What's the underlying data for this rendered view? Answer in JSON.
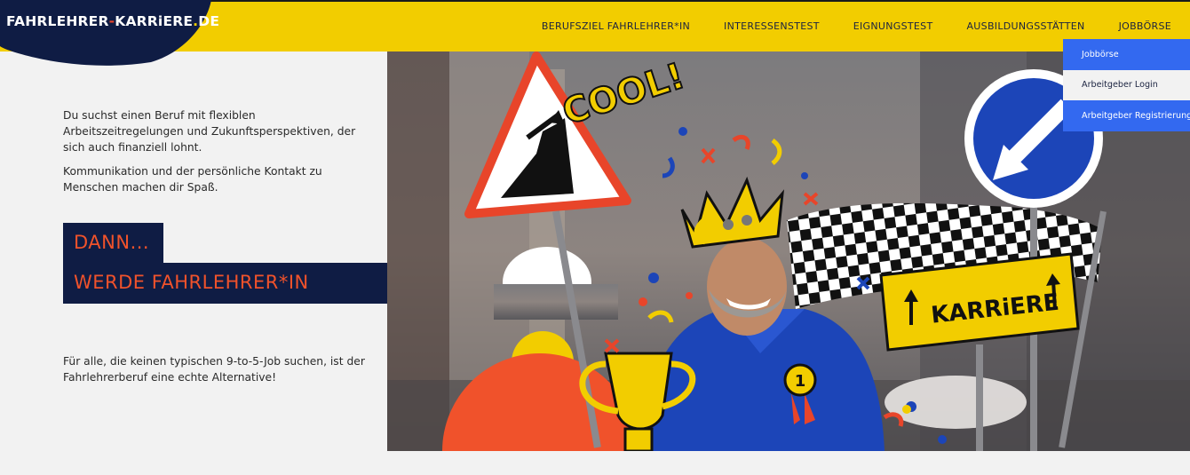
{
  "logo": {
    "part1": "FAHRLEHRER",
    "dash": "-",
    "part2": "KARRiERE",
    "dot": ".",
    "part3": "DE"
  },
  "nav": {
    "items": [
      {
        "label": "BERUFSZIEL FAHRLEHRER*IN"
      },
      {
        "label": "INTERESSENSTEST"
      },
      {
        "label": "EIGNUNGSTEST"
      },
      {
        "label": "AUSBILDUNGSSTÄTTEN"
      },
      {
        "label": "JOBBÖRSE"
      }
    ]
  },
  "dropdown": {
    "items": [
      {
        "label": "Jobbörse"
      },
      {
        "label": "Arbeitgeber Login"
      },
      {
        "label": "Arbeitgeber Registrierung"
      }
    ]
  },
  "content": {
    "intro1": "Du suchst einen Beruf mit flexiblen Arbeitszeitregelungen und Zukunftsperspektiven, der sich auch finanziell lohnt.",
    "intro2": "Kommunikation und der persönliche Kontakt zu Menschen machen dir Spaß.",
    "cta_line1": "DANN...",
    "cta_line2": "WERDE FAHRLEHRER*IN",
    "outro": "Für alle, die keinen typischen 9-to-5-Job suchen, ist der Fahrlehrerberuf eine echte Alternative!"
  },
  "hero": {
    "sign_cool": "COOL!",
    "sign_karriere": "KARRiERE",
    "badge": "1"
  },
  "colors": {
    "yellow": "#f2cd00",
    "navy": "#0f1c44",
    "orange": "#f0522b",
    "blue": "#3369f0"
  }
}
